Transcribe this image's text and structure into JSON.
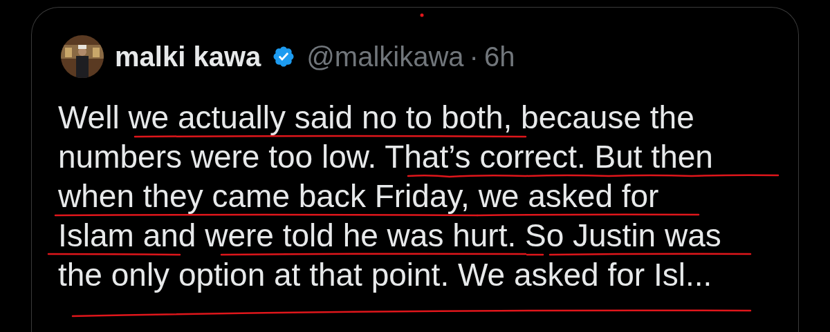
{
  "post": {
    "author": "malki kawa",
    "verified": true,
    "handle": "@malkikawa",
    "separator": "·",
    "time": "6h",
    "lines": [
      "Well we actually said no to both, because the",
      "numbers were too low. That’s correct. But then",
      "when they came back Friday, we asked for",
      "Islam and were told he was hurt. So Justin was",
      "the only option at that point. We asked for Isl..."
    ]
  }
}
